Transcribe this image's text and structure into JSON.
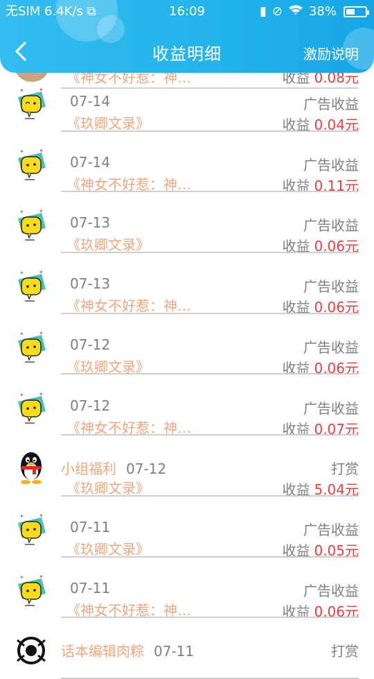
{
  "status_bar": {
    "carrier": "无SIM",
    "net_speed": "6.4K/s",
    "time": "16:09",
    "battery": "38%"
  },
  "header": {
    "title": "收益明细",
    "explain_label": "激励说明",
    "bg_color": "#22b4ea"
  },
  "colors": {
    "book": "#efa77c",
    "amount": "#ee3d3d",
    "text": "#7f7f7f"
  },
  "rows": [
    {
      "avatar": "cat-avatar",
      "group": "",
      "date": "07-14",
      "book": "《玖卿文录》",
      "type": "广告收益",
      "income_label": "收益",
      "amount": "0.04元"
    },
    {
      "avatar": "toast-avatar",
      "group": "",
      "date": "07-14",
      "book": "《神女不好惹：神…",
      "type": "广告收益",
      "income_label": "收益",
      "amount": "0.11元"
    },
    {
      "avatar": "toast-avatar",
      "group": "",
      "date": "07-13",
      "book": "《玖卿文录》",
      "type": "广告收益",
      "income_label": "收益",
      "amount": "0.06元"
    },
    {
      "avatar": "toast-avatar",
      "group": "",
      "date": "07-13",
      "book": "《神女不好惹：神…",
      "type": "广告收益",
      "income_label": "收益",
      "amount": "0.06元"
    },
    {
      "avatar": "toast-avatar",
      "group": "",
      "date": "07-12",
      "book": "《玖卿文录》",
      "type": "广告收益",
      "income_label": "收益",
      "amount": "0.06元"
    },
    {
      "avatar": "toast-avatar",
      "group": "",
      "date": "07-12",
      "book": "《神女不好惹：神…",
      "type": "广告收益",
      "income_label": "收益",
      "amount": "0.07元"
    },
    {
      "avatar": "penguin-avatar",
      "group": "小组福利",
      "date": "07-12",
      "book": "《玖卿文录》",
      "type": "打赏",
      "income_label": "收益",
      "amount": "5.04元"
    },
    {
      "avatar": "toast-avatar",
      "group": "",
      "date": "07-11",
      "book": "《玖卿文录》",
      "type": "广告收益",
      "income_label": "收益",
      "amount": "0.05元"
    },
    {
      "avatar": "toast-avatar",
      "group": "",
      "date": "07-11",
      "book": "《神女不好惹：神…",
      "type": "广告收益",
      "income_label": "收益",
      "amount": "0.06元"
    },
    {
      "avatar": "bw-avatar",
      "group": "话本编辑肉粽",
      "date": "07-11",
      "book": "",
      "type": "打赏",
      "income_label": "",
      "amount": ""
    }
  ],
  "partial_top_row": {
    "book": "《神女不好惹：神…",
    "income_label": "收益",
    "amount": "0.08元"
  }
}
